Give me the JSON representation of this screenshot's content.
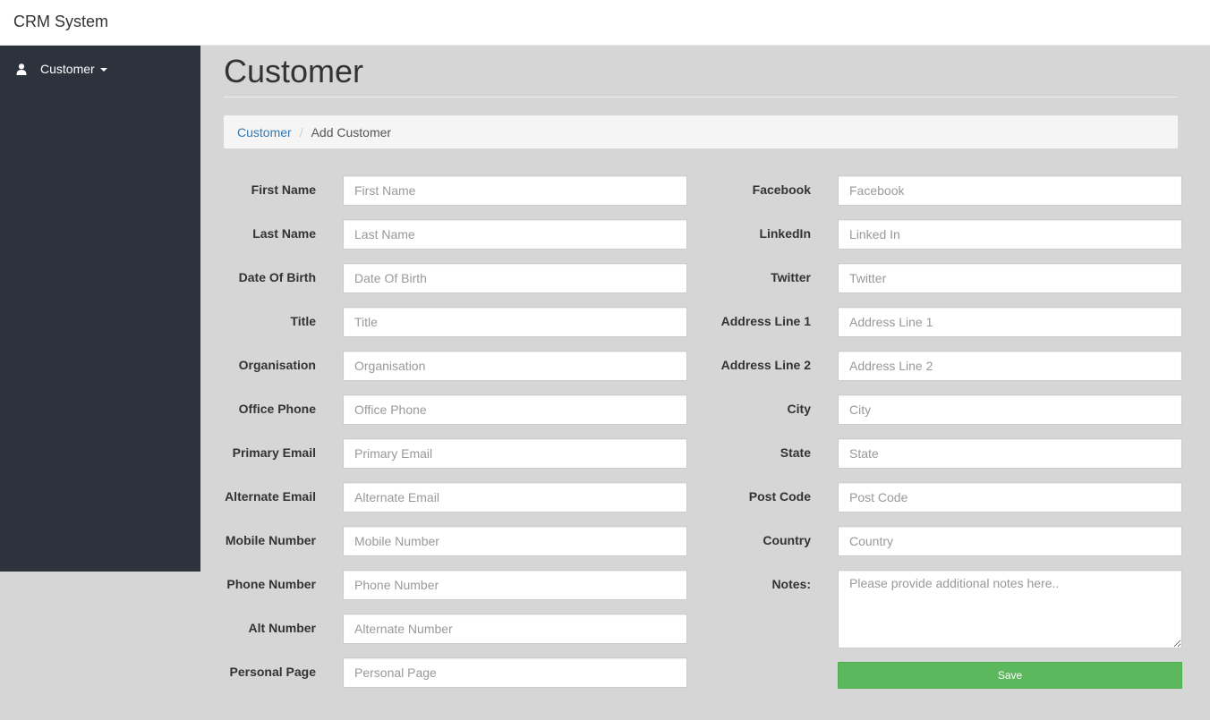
{
  "navbar": {
    "brand": "CRM System"
  },
  "sidebar": {
    "items": [
      {
        "label": "Customer",
        "icon": "user-icon"
      }
    ]
  },
  "page": {
    "title": "Customer"
  },
  "breadcrumb": {
    "parent": "Customer",
    "current": "Add Customer"
  },
  "form": {
    "left": [
      {
        "label": "First Name",
        "placeholder": "First Name",
        "value": ""
      },
      {
        "label": "Last Name",
        "placeholder": "Last Name",
        "value": ""
      },
      {
        "label": "Date Of Birth",
        "placeholder": "Date Of Birth",
        "value": ""
      },
      {
        "label": "Title",
        "placeholder": "Title",
        "value": ""
      },
      {
        "label": "Organisation",
        "placeholder": "Organisation",
        "value": ""
      },
      {
        "label": "Office Phone",
        "placeholder": "Office Phone",
        "value": ""
      },
      {
        "label": "Primary Email",
        "placeholder": "Primary Email",
        "value": ""
      },
      {
        "label": "Alternate Email",
        "placeholder": "Alternate Email",
        "value": ""
      },
      {
        "label": "Mobile Number",
        "placeholder": "Mobile Number",
        "value": ""
      },
      {
        "label": "Phone Number",
        "placeholder": "Phone Number",
        "value": ""
      },
      {
        "label": "Alt Number",
        "placeholder": "Alternate Number",
        "value": ""
      },
      {
        "label": "Personal Page",
        "placeholder": "Personal Page",
        "value": ""
      }
    ],
    "right": [
      {
        "label": "Facebook",
        "placeholder": "Facebook",
        "value": ""
      },
      {
        "label": "LinkedIn",
        "placeholder": "Linked In",
        "value": ""
      },
      {
        "label": "Twitter",
        "placeholder": "Twitter",
        "value": ""
      },
      {
        "label": "Address Line 1",
        "placeholder": "Address Line 1",
        "value": ""
      },
      {
        "label": "Address Line 2",
        "placeholder": "Address Line 2",
        "value": ""
      },
      {
        "label": "City",
        "placeholder": "City",
        "value": ""
      },
      {
        "label": "State",
        "placeholder": "State",
        "value": ""
      },
      {
        "label": "Post Code",
        "placeholder": "Post Code",
        "value": ""
      },
      {
        "label": "Country",
        "placeholder": "Country",
        "value": ""
      }
    ],
    "notes": {
      "label": "Notes:",
      "placeholder": "Please provide additional notes here..",
      "value": ""
    },
    "save_label": "Save"
  },
  "colors": {
    "sidebar_bg": "#2c333c",
    "page_bg": "#d6d6d6",
    "save_button": "#5cb85c",
    "link": "#337ab7"
  }
}
